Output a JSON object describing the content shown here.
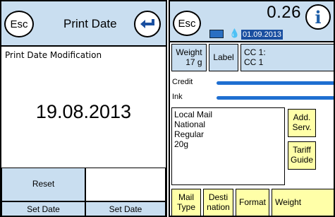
{
  "left": {
    "esc_label": "Esc",
    "title": "Print Date",
    "section_label": "Print Date Modification",
    "date": "19.08.2013",
    "reset_label": "Reset",
    "blank_label": "",
    "set_minus_line1": "Set Date",
    "set_minus_line2": "(-)",
    "set_plus_line1": "Set Date",
    "set_plus_line2": "(+)"
  },
  "right": {
    "esc_label": "Esc",
    "amount": "0.26",
    "date_badge": "01.09.2013",
    "weight_line1": "Weight",
    "weight_line2": "17 g",
    "label_button": "Label",
    "cc_line1": "CC 1:",
    "cc_line2": "CC 1",
    "credit_label": "Credit",
    "ink_label": "Ink",
    "mail_lines": [
      "Local Mail",
      "National",
      "Regular",
      "20g"
    ],
    "add_serv_line1": "Add.",
    "add_serv_line2": "Serv.",
    "tariff_line1": "Tariff",
    "tariff_line2": "Guide",
    "mail_type_line1": "Mail",
    "mail_type_line2": "Type",
    "destination_line1": "Desti",
    "destination_line2": "nation",
    "format_label": "Format",
    "weight_bottom": "Weight"
  },
  "levels": {
    "credit_fraction": 1.0,
    "ink_fraction": 1.0
  },
  "icons": {
    "enter": "enter-arrow-icon",
    "info": "info-icon",
    "card": "card-icon",
    "ink": "ink-drop-icon"
  },
  "colors": {
    "header": "#c9def0",
    "button_blue": "#c9def0",
    "button_yellow": "#ffffa8",
    "accent": "#1a4fa0"
  }
}
